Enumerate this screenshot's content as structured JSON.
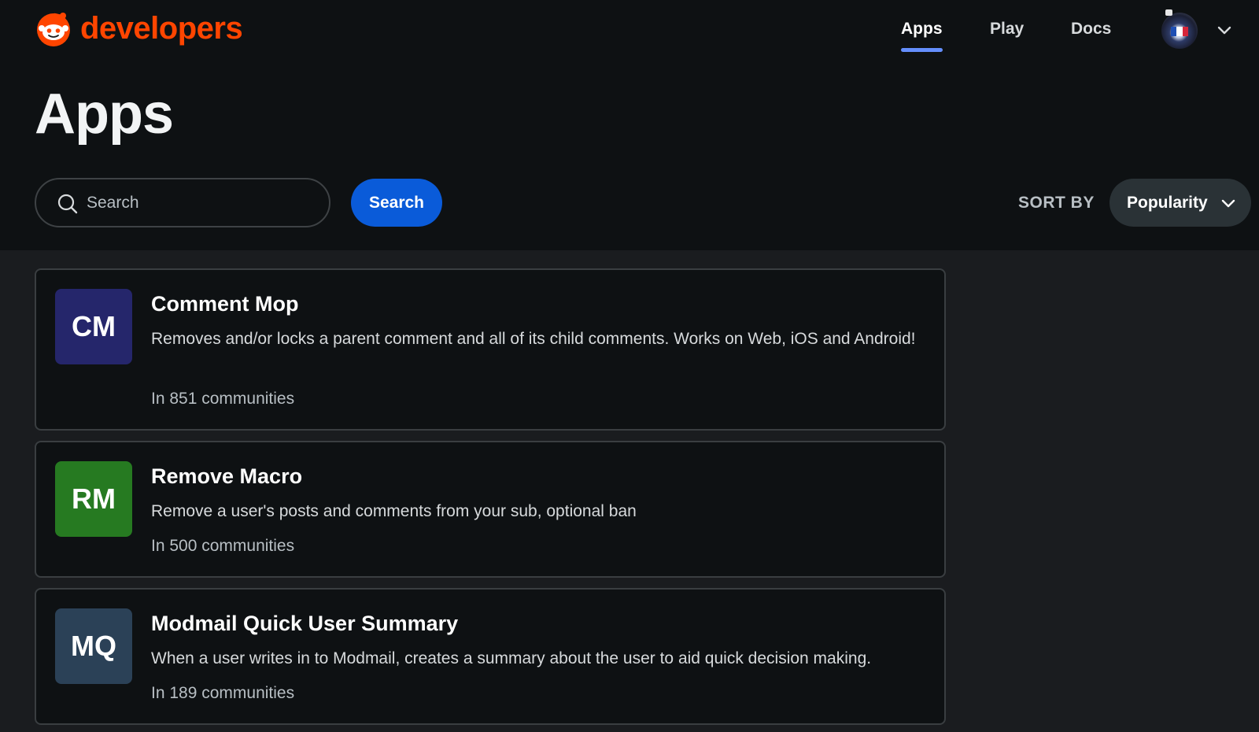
{
  "header": {
    "logo_text": "developers",
    "nav": [
      {
        "label": "Apps",
        "active": true
      },
      {
        "label": "Play",
        "active": false
      },
      {
        "label": "Docs",
        "active": false
      }
    ],
    "accent_color": "#ff4500",
    "active_underline_color": "#648efc"
  },
  "page": {
    "title": "Apps"
  },
  "search": {
    "placeholder": "Search",
    "value": "",
    "button_label": "Search",
    "button_color": "#0a5bd9"
  },
  "sort": {
    "label": "SORT BY",
    "selected": "Popularity"
  },
  "apps": [
    {
      "initials": "CM",
      "name": "Comment Mop",
      "description": "Removes and/or locks a parent comment and all of its child comments. Works on Web, iOS and Android!",
      "communities": "In 851 communities",
      "color": "#25266b"
    },
    {
      "initials": "RM",
      "name": "Remove Macro",
      "description": "Remove a user's posts and comments from your sub, optional ban",
      "communities": "In 500 communities",
      "color": "#267a21"
    },
    {
      "initials": "MQ",
      "name": "Modmail Quick User Summary",
      "description": "When a user writes in to Modmail, creates a summary about the user to aid quick decision making.",
      "communities": "In 189 communities",
      "color": "#2b4157"
    }
  ]
}
